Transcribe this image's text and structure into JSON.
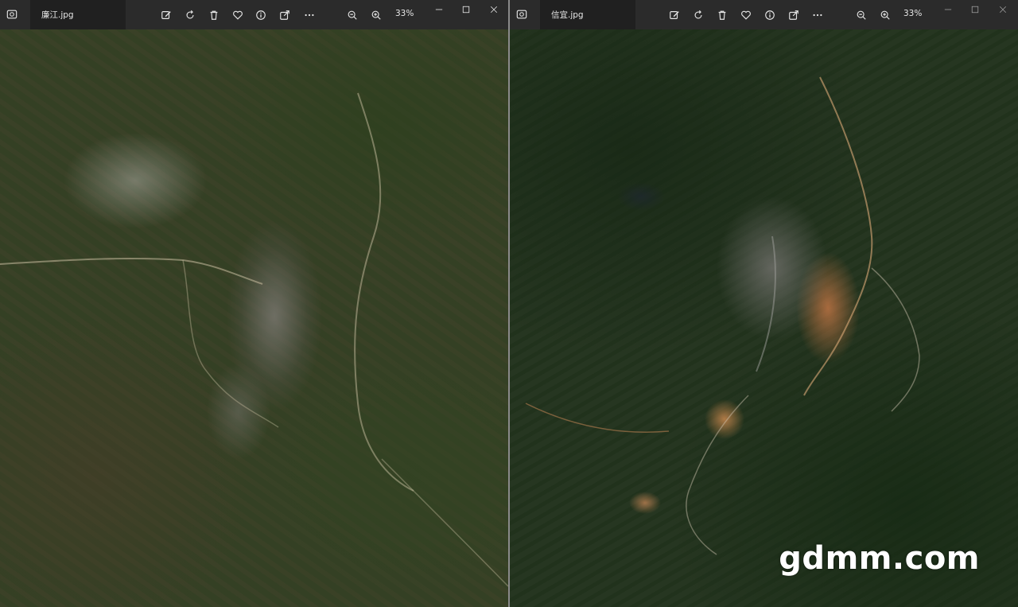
{
  "windows": [
    {
      "id": "left",
      "tab_title": "廉江.jpg",
      "zoom_level": "33%"
    },
    {
      "id": "right",
      "tab_title": "信宜.jpg",
      "zoom_level": "33%"
    }
  ],
  "toolbar_icons": [
    "edit-icon",
    "rotate-icon",
    "delete-icon",
    "favorite-icon",
    "info-icon",
    "share-icon",
    "more-icon",
    "zoom-out-icon",
    "zoom-in-icon"
  ],
  "window_controls": [
    "minimize-icon",
    "maximize-icon",
    "close-icon"
  ],
  "watermark": "gdmm.com",
  "colors": {
    "titlebar": "#2b2b2b",
    "tab": "#202020",
    "icon": "#e6e6e6",
    "divider": "#8a8a8a"
  }
}
